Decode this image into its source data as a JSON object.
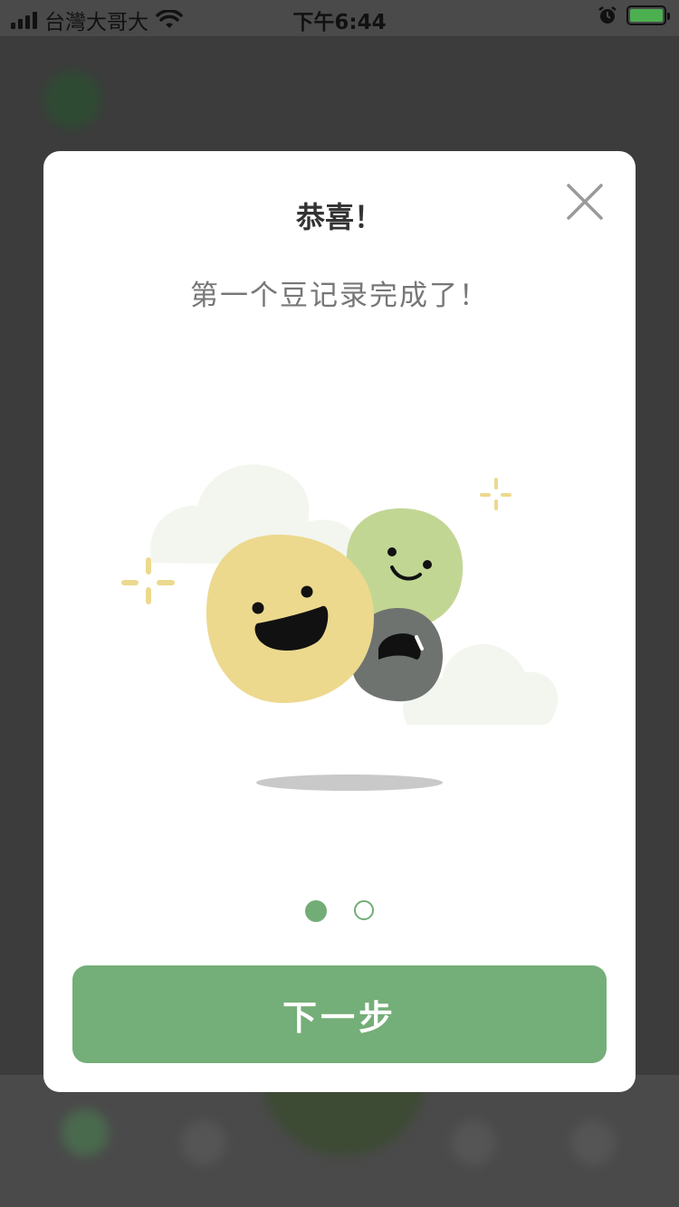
{
  "status_bar": {
    "carrier": "台灣大哥大",
    "time": "下午6:44",
    "battery_color": "#4caf50"
  },
  "modal": {
    "title": "恭喜！",
    "subtitle": "第一个豆记录完成了！",
    "next_label": "下一步",
    "close_icon": "close-icon",
    "pagination": {
      "current": 1,
      "total": 2
    },
    "accent_color": "#74ae78"
  },
  "illustration": {
    "beans": [
      {
        "mood": "laughing",
        "color": "#ecd98e"
      },
      {
        "mood": "smiling",
        "color": "#c2d694"
      },
      {
        "mood": "crying",
        "color": "#6e7370"
      }
    ]
  }
}
